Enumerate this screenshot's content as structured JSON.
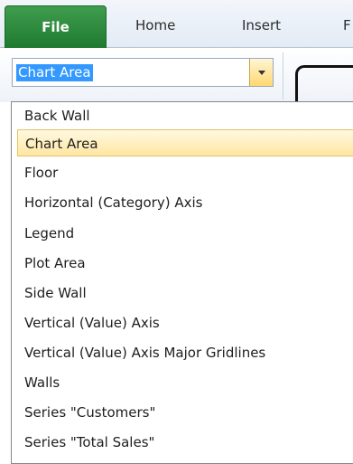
{
  "ribbon": {
    "tabs": [
      "File",
      "Home",
      "Insert",
      "F"
    ]
  },
  "combo": {
    "value": "Chart Area"
  },
  "dropdown": {
    "items": [
      "Back Wall",
      "Chart Area",
      "Floor",
      "Horizontal (Category) Axis",
      "Legend",
      "Plot Area",
      "Side Wall",
      "Vertical (Value) Axis",
      "Vertical (Value) Axis Major Gridlines",
      "Walls",
      "Series \"Customers\"",
      "Series \"Total Sales\""
    ],
    "selected": "Chart Area"
  },
  "colors": {
    "file_tab": "#2a8a3b",
    "highlight": "#ffe7a2",
    "selection": "#3399ff"
  }
}
